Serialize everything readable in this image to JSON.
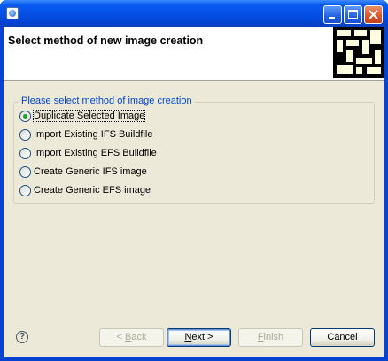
{
  "header": {
    "title": "Select method of new image creation"
  },
  "group": {
    "legend": "Please select method of image creation",
    "options": [
      {
        "label": "Duplicate Selected Image",
        "checked": true
      },
      {
        "label": "Import Existing IFS Buildfile",
        "checked": false
      },
      {
        "label": "Import Existing EFS Buildfile",
        "checked": false
      },
      {
        "label": "Create Generic IFS image",
        "checked": false
      },
      {
        "label": "Create Generic EFS image",
        "checked": false
      }
    ]
  },
  "buttons": {
    "back": {
      "prefix": "< ",
      "mnemonic": "B",
      "rest": "ack"
    },
    "next": {
      "mnemonic": "N",
      "rest": "ext >"
    },
    "finish": {
      "mnemonic": "F",
      "rest": "inish"
    },
    "cancel": "Cancel"
  },
  "help_glyph": "?",
  "colors": {
    "titlebar": "#0450e6",
    "legend": "#0046d5",
    "dialog_bg": "#ece9d8",
    "radio_dot": "#21a121"
  }
}
